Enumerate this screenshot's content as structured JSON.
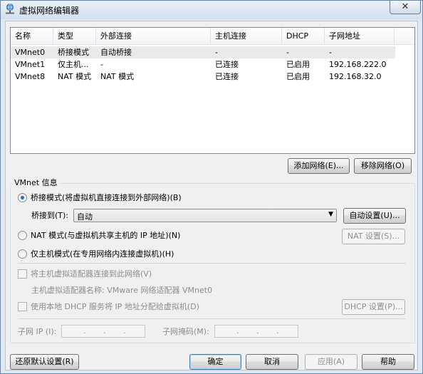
{
  "window": {
    "title": "虚拟网络编辑器",
    "close_glyph": "✕"
  },
  "list": {
    "headers": [
      "名称",
      "类型",
      "外部连接",
      "主机连接",
      "DHCP",
      "子网地址"
    ],
    "rows": [
      [
        "VMnet0",
        "桥接模式",
        "自动桥接",
        "-",
        "-",
        "-"
      ],
      [
        "VMnet1",
        "仅主机...",
        "-",
        "已连接",
        "已启用",
        "192.168.222.0"
      ],
      [
        "VMnet8",
        "NAT 模式",
        "NAT 模式",
        "已连接",
        "已启用",
        "192.168.32.0"
      ]
    ]
  },
  "list_buttons": {
    "add": "添加网络(E)...",
    "remove": "移除网络(O)"
  },
  "vmnet_info": {
    "title": "VMnet 信息",
    "radio_bridge": "桥接模式(将虚拟机直接连接到外部网络)(B)",
    "bridge_to_label": "桥接到(T):",
    "bridge_to_value": "自动",
    "auto_settings": "自动设置(U)...",
    "radio_nat": "NAT 模式(与虚拟机共享主机的 IP 地址)(N)",
    "nat_settings": "NAT 设置(S)...",
    "radio_hostonly": "仅主机模式(在专用网络内连接虚拟机)(H)",
    "check_adapter": "将主机虚拟适配器连接到此网络(V)",
    "adapter_name": "主机虚拟适配器名称: VMware 网络适配器 VMnet0",
    "check_dhcp": "使用本地 DHCP 服务将 IP 地址分配给虚拟机(D)",
    "dhcp_settings": "DHCP 设置(P)...",
    "subnet_ip_label": "子网 IP (I):",
    "subnet_mask_label": "子网掩码(M):",
    "ip_dot": "."
  },
  "footer": {
    "restore": "还原默认设置(R)",
    "ok": "确定",
    "cancel": "取消",
    "apply": "应用(A)",
    "help": "帮助"
  },
  "icons": {
    "title": "network-globe-icon",
    "combo_arrow": "▼"
  },
  "colors": {
    "selected_row": "#e9eaec",
    "radio_dot": "#1c6ec8",
    "titlebar": "#dfe8f3"
  }
}
